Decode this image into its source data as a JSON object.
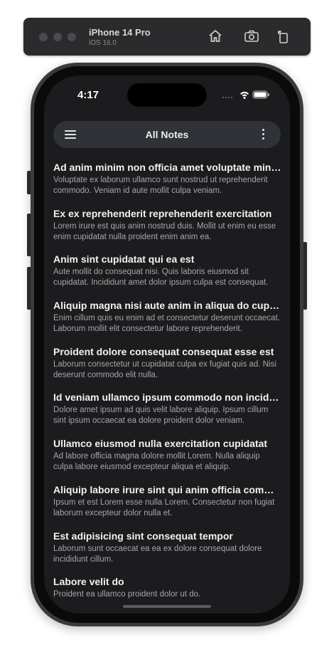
{
  "simulator": {
    "device_name": "iPhone 14 Pro",
    "os_version": "iOS 16.0"
  },
  "status_bar": {
    "time": "4:17"
  },
  "appbar": {
    "title": "All Notes"
  },
  "notes": [
    {
      "title": "Ad anim minim non officia amet voluptate minim",
      "body": "Voluptate ex laborum ullamco sunt nostrud ut reprehenderit commodo. Veniam id aute mollit culpa veniam."
    },
    {
      "title": "Ex ex reprehenderit reprehenderit exercitation",
      "body": "Lorem irure est quis anim nostrud duis. Mollit ut enim eu esse enim cupidatat nulla proident enim anim ea."
    },
    {
      "title": "Anim sint cupidatat qui ea est",
      "body": "Aute mollit do consequat nisi. Quis laboris eiusmod sit cupidatat. Incididunt amet dolor ipsum culpa est consequat."
    },
    {
      "title": "Aliquip magna nisi aute anim in aliqua do cupidatat",
      "body": "Enim cillum quis eu enim ad et consectetur deserunt occaecat. Laborum mollit elit consectetur labore reprehenderit."
    },
    {
      "title": "Proident dolore consequat consequat esse est",
      "body": "Laborum consectetur ut cupidatat culpa ex fugiat quis ad. Nisi deserunt commodo elit nulla."
    },
    {
      "title": "Id veniam ullamco ipsum commodo non incididunt",
      "body": "Dolore amet ipsum ad quis velit labore aliquip. Ipsum cillum sint ipsum occaecat ea dolore proident dolor veniam."
    },
    {
      "title": "Ullamco eiusmod nulla exercitation cupidatat",
      "body": "Ad labore officia magna dolore mollit Lorem. Nulla aliquip culpa labore eiusmod excepteur aliqua et aliquip."
    },
    {
      "title": "Aliquip labore irure sint qui anim officia commodo",
      "body": "Ipsum et est Lorem esse nulla Lorem. Consectetur non fugiat laborum excepteur dolor nulla et."
    },
    {
      "title": "Est adipisicing sint consequat tempor",
      "body": "Laborum sunt occaecat ea ea ex dolore consequat dolore incididunt cillum."
    },
    {
      "title": "Labore velit do",
      "body": "Proident ea ullamco proident dolor ut do."
    }
  ],
  "icons": {
    "toolbar": [
      "home-icon",
      "screenshot-icon",
      "rotate-icon"
    ],
    "status": [
      "cellular-icon",
      "wifi-icon",
      "battery-icon"
    ],
    "appbar": [
      "hamburger-menu-icon",
      "more-vertical-icon"
    ]
  }
}
